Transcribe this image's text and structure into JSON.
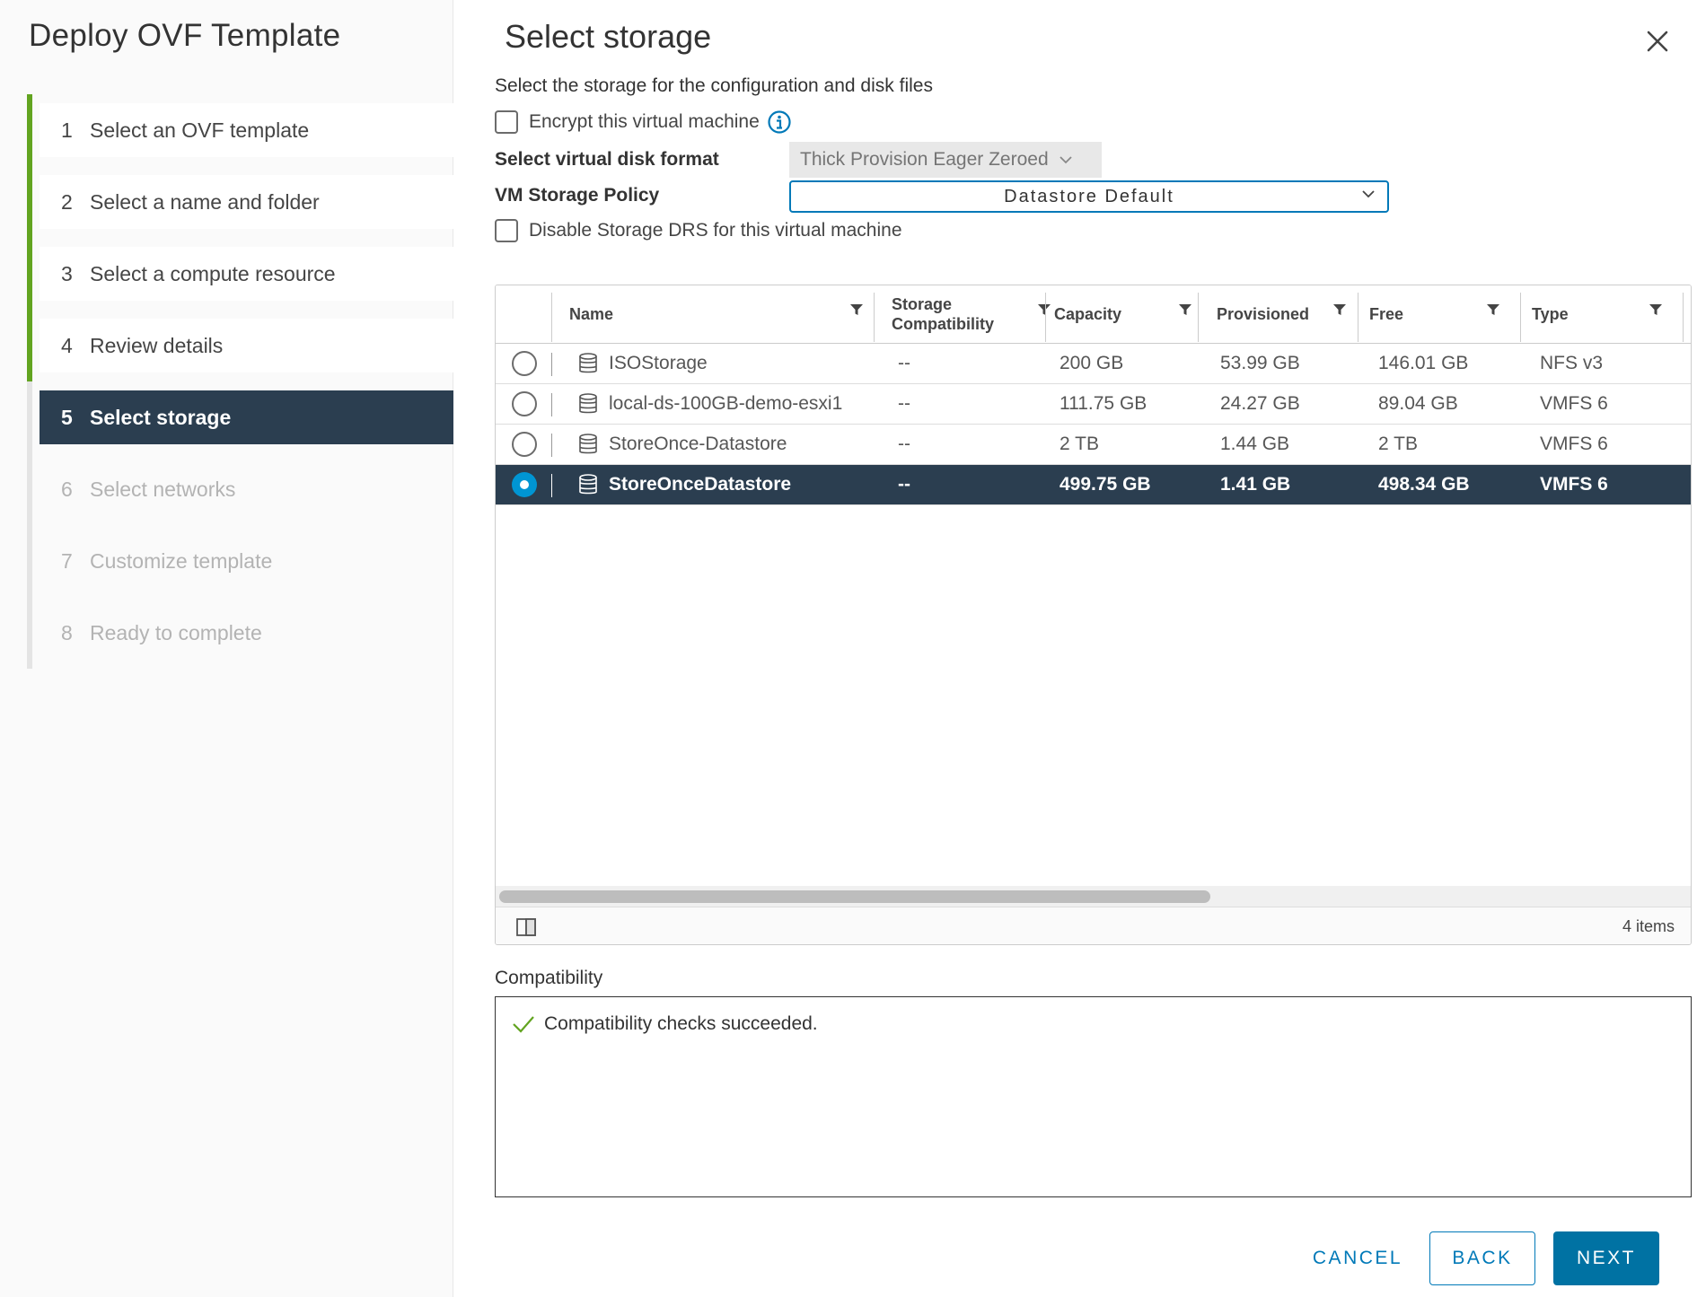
{
  "wizard": {
    "title": "Deploy OVF Template",
    "steps": [
      {
        "num": "1",
        "label": "Select an OVF template",
        "state": "done"
      },
      {
        "num": "2",
        "label": "Select a name and folder",
        "state": "done"
      },
      {
        "num": "3",
        "label": "Select a compute resource",
        "state": "done"
      },
      {
        "num": "4",
        "label": "Review details",
        "state": "done"
      },
      {
        "num": "5",
        "label": "Select storage",
        "state": "active"
      },
      {
        "num": "6",
        "label": "Select networks",
        "state": "todo"
      },
      {
        "num": "7",
        "label": "Customize template",
        "state": "todo"
      },
      {
        "num": "8",
        "label": "Ready to complete",
        "state": "todo"
      }
    ]
  },
  "page": {
    "title": "Select storage",
    "subtitle": "Select the storage for the configuration and disk files",
    "encrypt_label": "Encrypt this virtual machine",
    "disk_format_label": "Select virtual disk format",
    "disk_format_value": "Thick Provision Eager Zeroed",
    "policy_label": "VM Storage Policy",
    "policy_value": "Datastore Default",
    "disable_drs_label": "Disable Storage DRS for this virtual machine"
  },
  "grid": {
    "columns": {
      "name": "Name",
      "compat_line1": "Storage",
      "compat_line2": "Compatibility",
      "capacity": "Capacity",
      "provisioned": "Provisioned",
      "free": "Free",
      "type": "Type"
    },
    "rows": [
      {
        "name": "ISOStorage",
        "compat": "--",
        "capacity": "200 GB",
        "provisioned": "53.99 GB",
        "free": "146.01 GB",
        "type": "NFS v3",
        "selected": false
      },
      {
        "name": "local-ds-100GB-demo-esxi1",
        "compat": "--",
        "capacity": "111.75 GB",
        "provisioned": "24.27 GB",
        "free": "89.04 GB",
        "type": "VMFS 6",
        "selected": false
      },
      {
        "name": "StoreOnce-Datastore",
        "compat": "--",
        "capacity": "2 TB",
        "provisioned": "1.44 GB",
        "free": "2 TB",
        "type": "VMFS 6",
        "selected": false
      },
      {
        "name": "StoreOnceDatastore",
        "compat": "--",
        "capacity": "499.75 GB",
        "provisioned": "1.41 GB",
        "free": "498.34 GB",
        "type": "VMFS 6",
        "selected": true
      }
    ],
    "item_count": "4 items"
  },
  "compatibility": {
    "label": "Compatibility",
    "message": "Compatibility checks succeeded."
  },
  "buttons": {
    "cancel": "CANCEL",
    "back": "BACK",
    "next": "NEXT"
  },
  "colors": {
    "accent": "#0079b8",
    "done_bar": "#62a420",
    "active_bg": "#2b3e50",
    "success": "#62a420"
  },
  "icons": {
    "close": "close-icon",
    "info": "info-icon",
    "filter": "filter-icon",
    "datastore": "database-icon",
    "columns": "column-toggle-icon",
    "check": "check-icon",
    "chevron": "chevron-down-icon"
  }
}
